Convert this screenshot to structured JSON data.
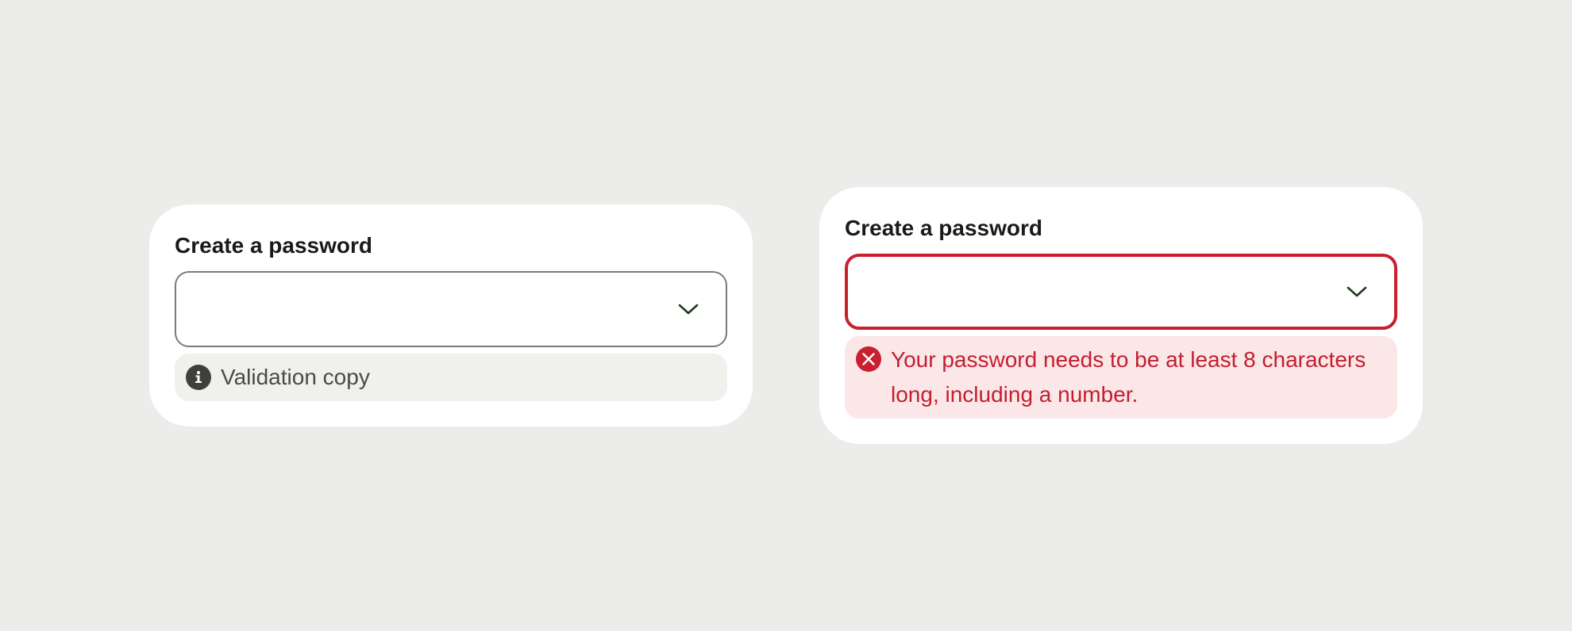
{
  "colors": {
    "background": "#ECEDEA",
    "card": "#FFFFFF",
    "label_text": "#1A1A1A",
    "default_border": "#7A7A7A",
    "default_message_bg": "#F0F0ED",
    "default_message_text": "#4A4A48",
    "info_icon": "#3F3F3D",
    "error_accent": "#C8202F",
    "error_message_bg": "#FBE7E8"
  },
  "default_field": {
    "label": "Create a password",
    "value": "",
    "chevron_icon": "chevron-down-icon",
    "message": {
      "icon": "info-icon",
      "text": "Validation copy"
    }
  },
  "error_field": {
    "label": "Create a password",
    "value": "",
    "chevron_icon": "chevron-down-icon",
    "message": {
      "icon": "error-x-icon",
      "text": "Your password needs to be at least 8 characters long, including a number."
    }
  }
}
